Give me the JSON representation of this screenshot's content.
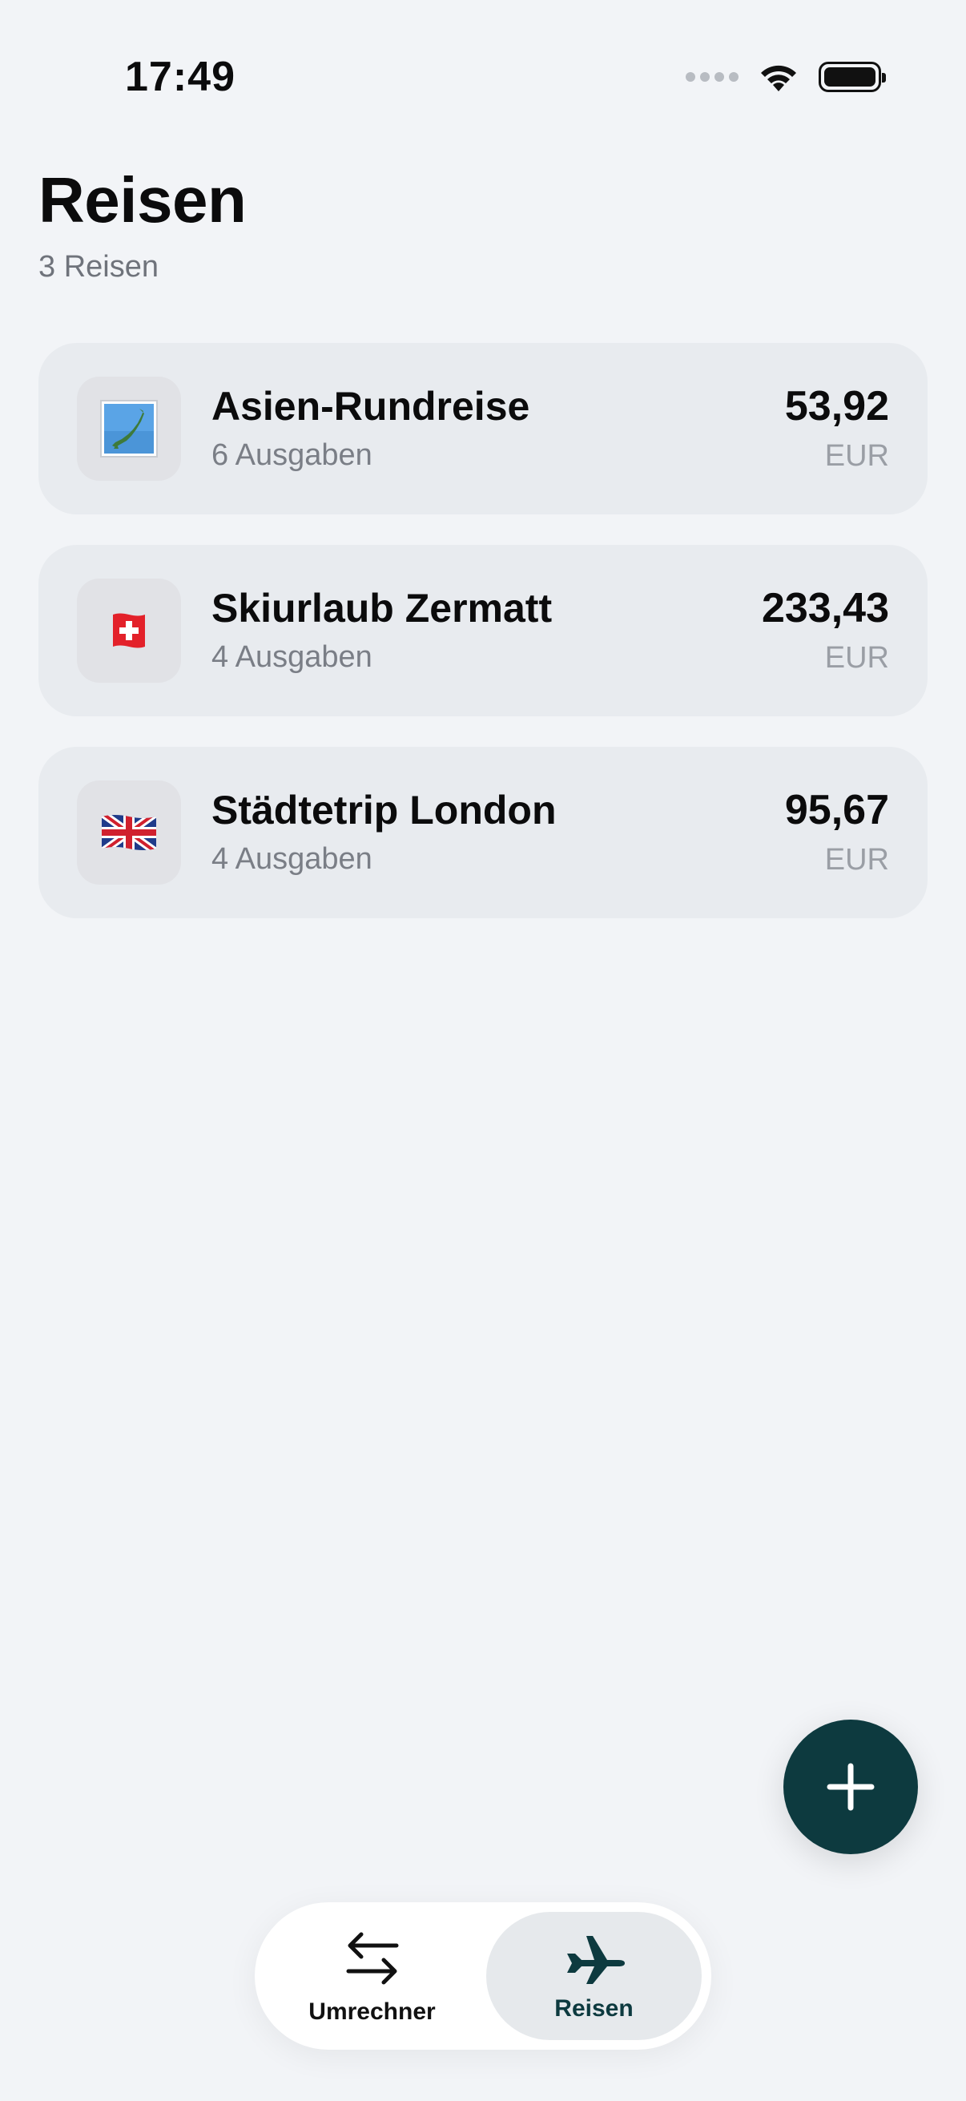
{
  "status_bar": {
    "time": "17:49",
    "icons": [
      "cellular-signal-icon",
      "wifi-icon",
      "battery-icon"
    ]
  },
  "header": {
    "title": "Reisen",
    "subtitle": "3 Reisen"
  },
  "trips": [
    {
      "icon": "japan-map-emoji",
      "name": "Asien-Rundreise",
      "count": "6 Ausgaben",
      "amount": "53,92",
      "currency": "EUR"
    },
    {
      "icon": "switzerland-flag-emoji",
      "name": "Skiurlaub Zermatt",
      "count": "4 Ausgaben",
      "amount": "233,43",
      "currency": "EUR"
    },
    {
      "icon": "uk-flag-emoji",
      "name": "Städtetrip London",
      "count": "4 Ausgaben",
      "amount": "95,67",
      "currency": "EUR"
    }
  ],
  "fab": {
    "icon": "plus-icon"
  },
  "tab_bar": {
    "tabs": [
      {
        "label": "Umrechner",
        "icon": "arrows-exchange-icon",
        "active": false
      },
      {
        "label": "Reisen",
        "icon": "airplane-icon",
        "active": true
      }
    ]
  },
  "colors": {
    "background": "#f2f4f7",
    "card": "#e8ebef",
    "accent": "#0d3a3f",
    "secondary_text": "#7a7e86"
  }
}
